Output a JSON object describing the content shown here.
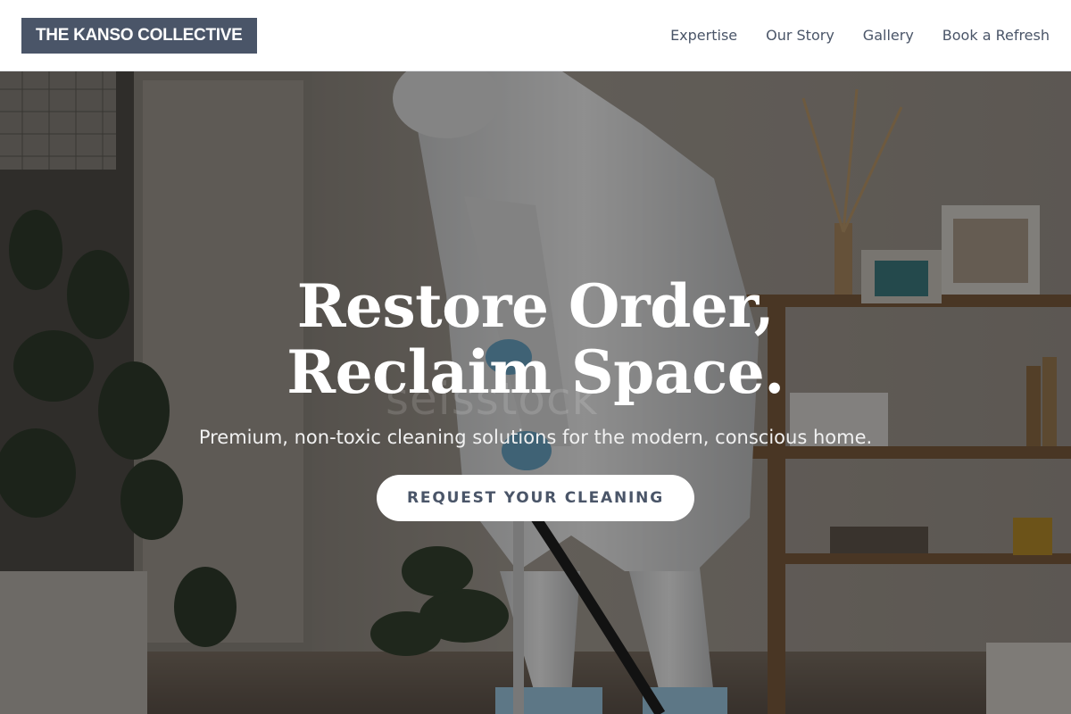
{
  "brand": {
    "name": "THE KANSO COLLECTIVE"
  },
  "nav": {
    "items": [
      {
        "label": "Expertise"
      },
      {
        "label": "Our Story"
      },
      {
        "label": "Gallery"
      },
      {
        "label": "Book a Refresh"
      }
    ]
  },
  "hero": {
    "title": "Restore Order, Reclaim Space.",
    "subtitle": "Premium, non-toxic cleaning solutions for the modern, conscious home.",
    "cta_label": "REQUEST YOUR CLEANING",
    "watermark": "seisstock"
  },
  "colors": {
    "brand_bg": "#4a5568",
    "nav_text": "#4a5568",
    "cta_bg": "#ffffff",
    "cta_text": "#4a5568"
  }
}
